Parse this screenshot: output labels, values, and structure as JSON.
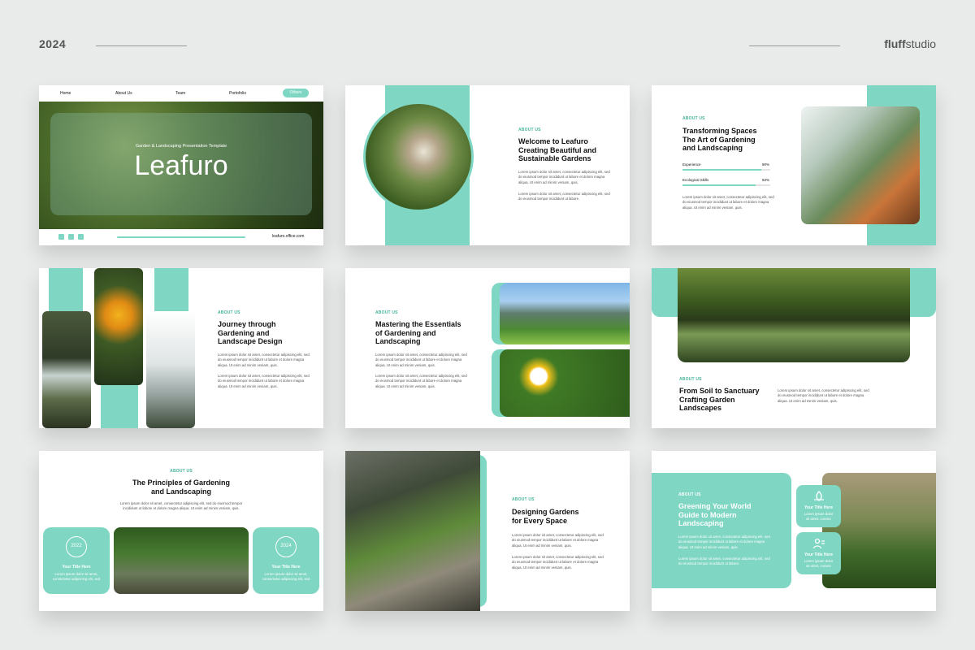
{
  "header": {
    "year": "2024",
    "brand_bold": "fluff",
    "brand_rest": "studio"
  },
  "slide1": {
    "nav": [
      "Home",
      "About Us",
      "Team",
      "Portofolio"
    ],
    "nav_button": "Others",
    "subtitle": "Garden & Landscaping Presentation Template",
    "title": "Leafuro",
    "website": "leafuro.office.com",
    "social_icons": [
      "linkedin-icon",
      "instagram-icon",
      "facebook-icon"
    ]
  },
  "slide2": {
    "label": "ABOUT US",
    "heading": [
      "Welcome to Leafuro",
      "Creating Beautiful and",
      "Sustainable Gardens"
    ],
    "p1": [
      "Lorem ipsum dolor sit amet, consectetur adipiscing elit, sed",
      "do eiusmod tempor incididunt ut labore et dolore magna",
      "aliqua. Ut enim ad minim veniam, quis."
    ],
    "p2": [
      "Lorem ipsum dolor sit amet, consectetur adipiscing elit, sed",
      "do eiusmod tempor incididunt ut labore."
    ]
  },
  "slide3": {
    "label": "ABOUT US",
    "heading": [
      "Transforming Spaces",
      "The Art of Gardening",
      "and Landscaping"
    ],
    "skills": [
      {
        "name": "Experience",
        "value": "90%",
        "fraction": 0.9
      },
      {
        "name": "Ecological Skills",
        "value": "83%",
        "fraction": 0.83
      }
    ],
    "p1": [
      "Lorem ipsum dolor sit amet, consectetur adipiscing elit, sed",
      "do eiusmod tempor incididunt ut labore et dolore magna",
      "aliqua. Ut enim ad minim veniam, quis."
    ]
  },
  "slide4": {
    "label": "ABOUT US",
    "heading": [
      "Journey through",
      "Gardening and",
      "Landscape Design"
    ],
    "p1": [
      "Lorem ipsum dolor sit amet, consectetur adipiscing elit, sed",
      "do eiusmod tempor incididunt ut labore et dolore magna",
      "aliqua. Ut enim ad minim veniam, quis."
    ],
    "p2": [
      "Lorem ipsum dolor sit amet, consectetur adipiscing elit, sed",
      "do eiusmod tempor incididunt ut labore et dolore magna",
      "aliqua. Ut enim ad minim veniam, quis."
    ]
  },
  "slide5": {
    "label": "ABOUT US",
    "heading": [
      "Mastering the Essentials",
      "of Gardening and",
      "Landscaping"
    ],
    "p1": [
      "Lorem ipsum dolor sit amet, consectetur adipiscing elit, sed",
      "do eiusmod tempor incididunt ut labore et dolore magna",
      "aliqua. Ut enim ad minim veniam, quis."
    ],
    "p2": [
      "Lorem ipsum dolor sit amet, consectetur adipiscing elit, sed",
      "do eiusmod tempor incididunt ut labore et dolore magna",
      "aliqua. Ut enim ad minim veniam, quis."
    ]
  },
  "slide6": {
    "label": "ABOUT US",
    "heading": [
      "From Soil to Sanctuary",
      "Crafting Garden",
      "Landscapes"
    ],
    "p1": [
      "Lorem ipsum dolor sit amet, consectetur adipiscing elit, sed",
      "do eiusmod tempor incididunt ut labore et dolore magna",
      "aliqua. Ut enim ad minim veniam, quis."
    ]
  },
  "slide7": {
    "label": "ABOUT US",
    "heading": [
      "The Principles of Gardening",
      "and Landscaping"
    ],
    "p1": [
      "Lorem ipsum dolor sit amet, consectetur adipiscing elit, sed do eiusmod tempor",
      "incididunt ut labore et dolore magna aliqua. Ut enim ad minim veniam, quis."
    ],
    "cards": [
      {
        "year": "2022",
        "title": "Your Title Here",
        "text": [
          "Lorem ipsum dolor sit amet,",
          "consectetur adipiscing elit, sed"
        ]
      },
      {
        "year": "2024",
        "title": "Your Title Here",
        "text": [
          "Lorem ipsum dolor sit amet,",
          "consectetur adipiscing elit, sed"
        ]
      }
    ]
  },
  "slide8": {
    "label": "ABOUT US",
    "heading": [
      "Designing Gardens",
      "for Every Space"
    ],
    "p1": [
      "Lorem ipsum dolor sit amet, consectetur adipiscing elit, sed",
      "do eiusmod tempor incididunt ut labore et dolore magna",
      "aliqua. Ut enim ad minim veniam, quis."
    ],
    "p2": [
      "Lorem ipsum dolor sit amet, consectetur adipiscing elit, sed",
      "do eiusmod tempor incididunt ut labore et dolore magna",
      "aliqua. Ut enim ad minim veniam, quis."
    ]
  },
  "slide9": {
    "label": "ABOUT US",
    "heading": [
      "Greening Your World",
      "Guide to Modern",
      "Landscaping"
    ],
    "p1": [
      "Lorem ipsum dolor sit amet, consectetur adipiscing elit, sed",
      "do eiusmod tempor incididunt ut labore et dolore magna",
      "aliqua. Ut enim ad minim veniam, quis."
    ],
    "p2": [
      "Lorem ipsum dolor sit amet, consectetur adipiscing elit, sed",
      "do eiusmod tempor incididunt ut labore."
    ],
    "items": [
      {
        "title": "Your Title Here",
        "text": [
          "Lorem ipsum dolor",
          "sit amet, consec"
        ]
      },
      {
        "title": "Your Title Here",
        "text": [
          "Lorem ipsum dolor",
          "sit amet, consec"
        ]
      }
    ]
  }
}
